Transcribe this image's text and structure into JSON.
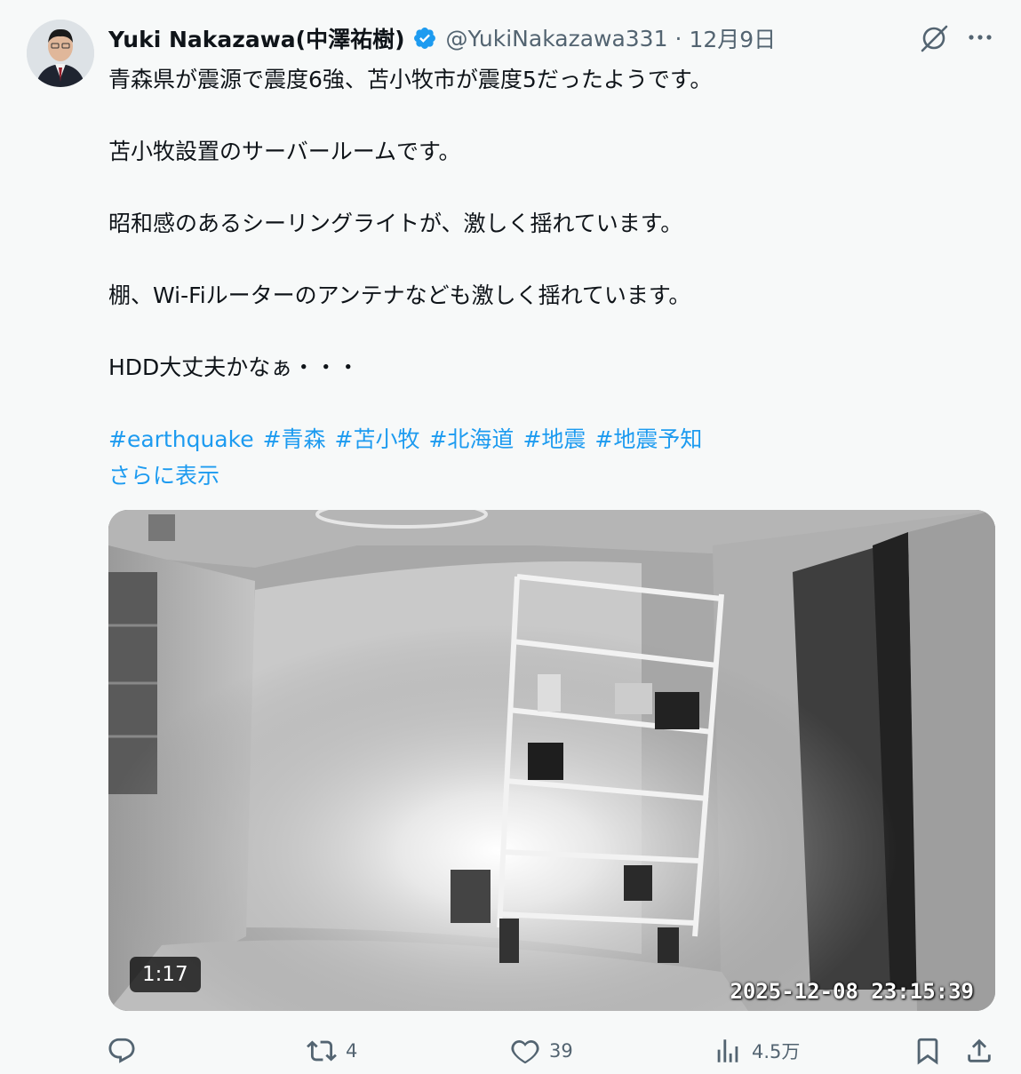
{
  "author": {
    "name": "Yuki Nakazawa(中澤祐樹)",
    "handle": "@YukiNakazawa331",
    "separator": "·",
    "date": "12月9日",
    "verified": true
  },
  "tweet": {
    "lines": [
      "青森県が震源で震度6強、苫小牧市が震度5だったようです。",
      "苫小牧設置のサーバールームです。",
      "昭和感のあるシーリングライトが、激しく揺れています。",
      "棚、Wi-Fiルーターのアンテナなども激しく揺れています。",
      "HDD大丈夫かなぁ・・・"
    ],
    "hashtags": [
      "#earthquake",
      "#青森",
      "#苫小牧",
      "#北海道",
      "#地震",
      "#地震予知"
    ],
    "show_more": "さらに表示"
  },
  "video": {
    "duration": "1:17",
    "timestamp": "2025-12-08 23:15:39"
  },
  "actions": {
    "reply": "",
    "retweet": "4",
    "like": "39",
    "views": "4.5万"
  },
  "icons": [
    "verified-badge-icon",
    "grok-icon",
    "more-icon",
    "reply-icon",
    "retweet-icon",
    "like-icon",
    "views-icon",
    "bookmark-icon",
    "share-icon"
  ],
  "colors": {
    "accent": "#1d9bf0",
    "secondary_text": "#536471",
    "background": "#f7f9f9"
  }
}
